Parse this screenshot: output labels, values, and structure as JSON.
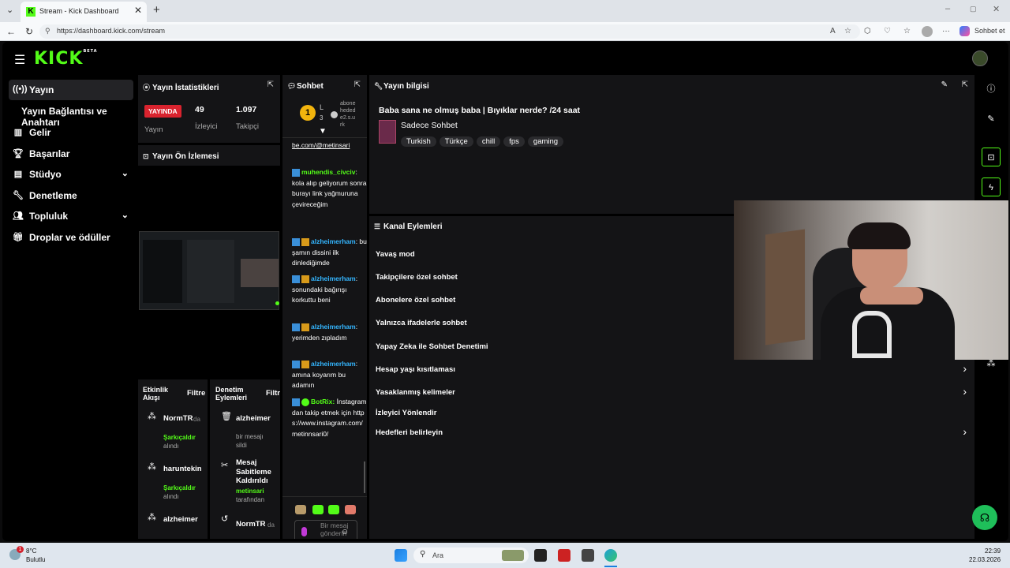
{
  "browser": {
    "tab_title": "Stream - Kick Dashboard",
    "url": "https://dashboard.kick.com/stream",
    "profile_btn": "Sohbet et"
  },
  "app": {
    "logo": "KICK",
    "logo_badge": "BETA"
  },
  "sidebar": {
    "items": [
      {
        "label": "Yayın",
        "icon": "broadcast-icon"
      },
      {
        "label": "Yayın Bağlantısı ve Anahtarı",
        "icon": ""
      },
      {
        "label": "Gelir",
        "icon": "chart-icon"
      },
      {
        "label": "Başarılar",
        "icon": "trophy-icon"
      },
      {
        "label": "Stüdyo",
        "icon": "studio-icon"
      },
      {
        "label": "Denetleme",
        "icon": "wrench-icon"
      },
      {
        "label": "Topluluk",
        "icon": "users-icon"
      },
      {
        "label": "Droplar ve ödüller",
        "icon": "gift-icon"
      }
    ]
  },
  "stats": {
    "title": "Yayın İstatistikleri",
    "live_badge": "YAYINDA",
    "viewers": "49",
    "followers": "1.097",
    "col1_label": "Yayın",
    "col2_label": "İzleyici",
    "col3_label": "Takipçi"
  },
  "preview": {
    "title": "Yayın Ön İzlemesi"
  },
  "activity": {
    "title_line1": "Etkinlik",
    "title_line2": "Akışı",
    "filter": "Filtre",
    "items": [
      {
        "user": "NormTR",
        "suffix": "da",
        "action": "Şarkıçaldır",
        "sub": "alındı"
      },
      {
        "user": "haruntekin",
        "suffix": "",
        "action": "Şarkıçaldır",
        "sub": "alındı"
      },
      {
        "user": "alzheimer",
        "suffix": "",
        "action": "",
        "sub": ""
      }
    ]
  },
  "moderation": {
    "title_line1": "Denetim",
    "title_line2": "Eylemleri",
    "filter": "Filtre",
    "items": [
      {
        "user": "alzheimer",
        "l1": "bir mesajı",
        "l2": "sildi"
      },
      {
        "user": "Mesaj Sabitleme Kaldırıldı",
        "l1": "metinsari",
        "l2": "tarafından"
      },
      {
        "user": "NormTR",
        "l1": "da",
        "l2": ""
      }
    ]
  },
  "chat": {
    "title": "Sohbet",
    "level_num": "1",
    "level_lbl": "L",
    "level_sub": "3",
    "sub_goal": "abonehedede2.s.urk",
    "messages": [
      {
        "user": "",
        "text": "be.com/@metinsari"
      },
      {
        "user": "muhendis_civciv",
        "text": ": kola alıp geliyorum sonra burayı link yağmuruna çevireceğim"
      },
      {
        "user": "alzheimerham",
        "text": ": bu şamın dissini ilk dinlediğimde"
      },
      {
        "user": "alzheimerham",
        "text": ": sonundaki bağırışı korkuttu beni"
      },
      {
        "user": "alzheimerham",
        "text": ": yerimden zıpladım"
      },
      {
        "user": "alzheimerham",
        "text": ": amına koyarım bu adamın"
      },
      {
        "user": "BotRix:",
        "text": "İnstagramdan takip etmek için https://www.instagram.com/metinnsari0/"
      }
    ],
    "input_placeholder": "Bir mesaj gönderin",
    "footer_count": "0"
  },
  "info": {
    "title": "Yayın bilgisi",
    "stream_title": "Baba sana ne olmuş baba | Bıyıklar nerde? /24 saat",
    "category": "Sadece Sohbet",
    "tags": [
      "Turkish",
      "Türkçe",
      "chill",
      "fps",
      "gaming"
    ]
  },
  "channel_actions": {
    "title": "Kanal Eylemleri",
    "items": [
      {
        "label": "Yavaş mod",
        "arrow": false
      },
      {
        "label": "Takipçilere özel sohbet",
        "arrow": false
      },
      {
        "label": "Abonelere özel sohbet",
        "arrow": false
      },
      {
        "label": "Yalnızca ifadelerle sohbet",
        "arrow": false
      },
      {
        "label": "Yapay Zeka ile Sohbet Denetimi",
        "arrow": false
      },
      {
        "label": "Hesap yaşı kısıtlaması",
        "arrow": true
      },
      {
        "label": "Yasaklanmış kelimeler",
        "arrow": true
      },
      {
        "label": "İzleyici Yönlendir",
        "arrow": false
      },
      {
        "label": "Hedefleri belirleyin",
        "arrow": true
      }
    ]
  },
  "taskbar": {
    "weather_temp": "8°C",
    "weather_desc": "Bulutlu",
    "notif": "1",
    "search": "Ara",
    "time": "22:39",
    "date": "22.03.2026"
  }
}
